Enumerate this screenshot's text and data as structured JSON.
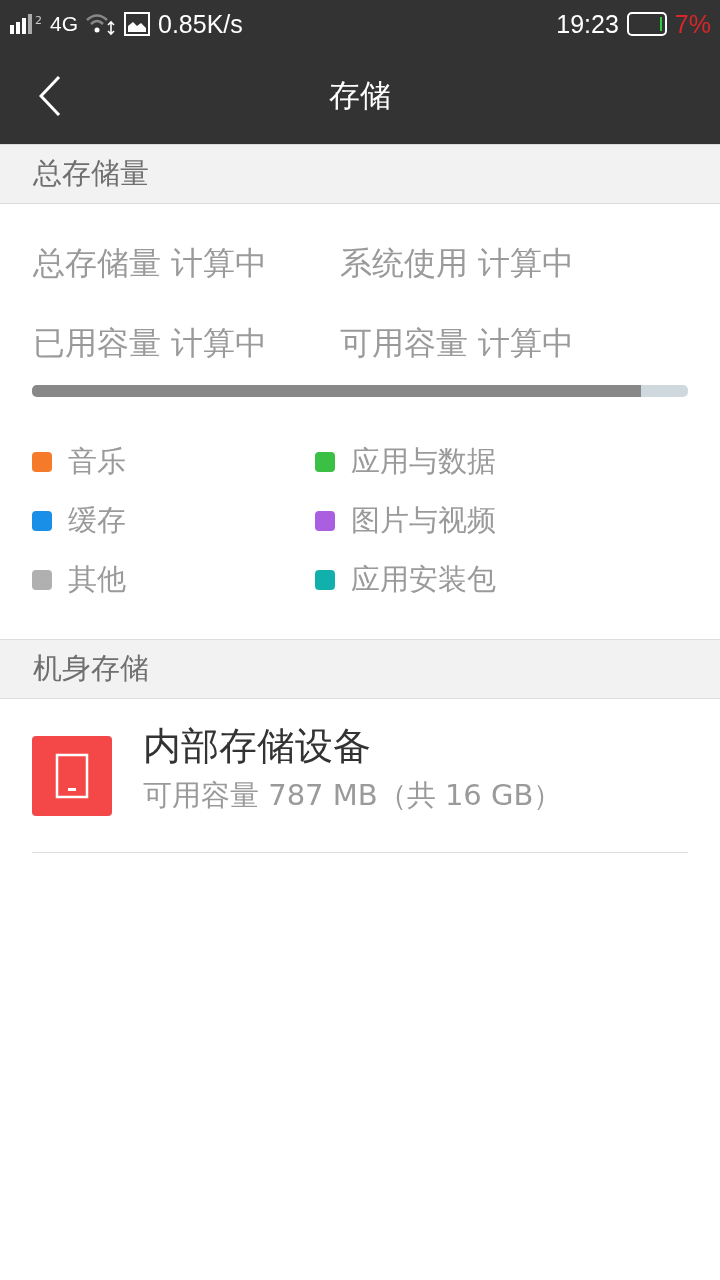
{
  "status_bar": {
    "sim_slot": "2",
    "network": "4G",
    "speed": "0.85K/s",
    "time": "19:23",
    "battery": "7%",
    "battery_low": true
  },
  "header": {
    "title": "存储"
  },
  "sections": [
    {
      "title": "总存储量",
      "stats": [
        {
          "label": "总存储量",
          "value": "计算中"
        },
        {
          "label": "系统使用",
          "value": "计算中"
        },
        {
          "label": "已用容量",
          "value": "计算中"
        },
        {
          "label": "可用容量",
          "value": "计算中"
        }
      ],
      "usage": {
        "level": 0.928
      },
      "legend": [
        {
          "label": "音乐",
          "color": "#f57a2a"
        },
        {
          "label": "应用与数据",
          "color": "#3cbf45"
        },
        {
          "label": "缓存",
          "color": "#1a8fe8"
        },
        {
          "label": "图片与视频",
          "color": "#a95fe0"
        },
        {
          "label": "其他",
          "color": "#b0b0b0"
        },
        {
          "label": "应用安装包",
          "color": "#11b0ad"
        }
      ]
    },
    {
      "title": "机身存储",
      "devices": [
        {
          "name": "内部存储设备",
          "detail": "可用容量 787 MB（共 16 GB）"
        }
      ]
    }
  ]
}
